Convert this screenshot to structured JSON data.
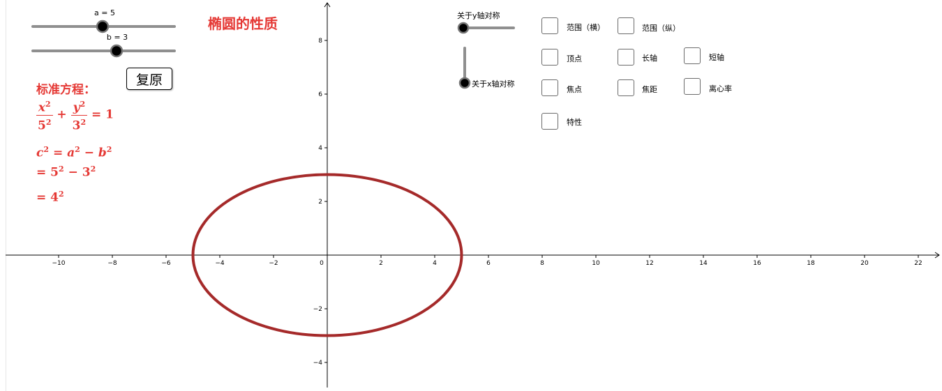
{
  "title": "椭圆的性质",
  "sliders": {
    "a": {
      "label": "a = 5",
      "value": 5
    },
    "b": {
      "label": "b = 3",
      "value": 3
    },
    "sym_y": {
      "label": "关于y轴对称"
    },
    "sym_x": {
      "label": "关于x轴对称"
    }
  },
  "reset_label": "复原",
  "equation": {
    "heading": "标准方程：",
    "num_x": "x",
    "den_a": "5",
    "num_y": "y",
    "den_b": "3",
    "exp": "2",
    "plus": "+",
    "eq_one": "= 1",
    "c_line1_lhs": "c",
    "c_line1_rhs_a": "a",
    "c_line1_rhs_b": "b",
    "c_line2_a": "5",
    "c_line2_b": "3",
    "c_line3": "4",
    "eq": "=",
    "minus": "−"
  },
  "checkboxes": [
    {
      "label": "范围（横）"
    },
    {
      "label": "范围（纵）"
    },
    {
      "label": "顶点"
    },
    {
      "label": "长轴"
    },
    {
      "label": "短轴"
    },
    {
      "label": "焦点"
    },
    {
      "label": "焦距"
    },
    {
      "label": "离心率"
    },
    {
      "label": "特性"
    }
  ],
  "axes": {
    "x_ticks": [
      "−10",
      "−8",
      "−6",
      "−4",
      "−2",
      "0",
      "2",
      "4",
      "6",
      "8",
      "10",
      "12",
      "14",
      "16",
      "18",
      "20",
      "22"
    ],
    "y_ticks": [
      "8",
      "6",
      "4",
      "2",
      "−2",
      "−4"
    ],
    "x_values": [
      -10,
      -8,
      -6,
      -4,
      -2,
      0,
      2,
      4,
      6,
      8,
      10,
      12,
      14,
      16,
      18,
      20,
      22
    ],
    "y_values": [
      8,
      6,
      4,
      2,
      -2,
      -4
    ]
  },
  "ellipse": {
    "a": 5,
    "b": 3,
    "color": "#a52a2a"
  },
  "colors": {
    "accent_red": "#e53935",
    "slider_track": "#8f8f8f",
    "slider_knob": "#000000"
  }
}
